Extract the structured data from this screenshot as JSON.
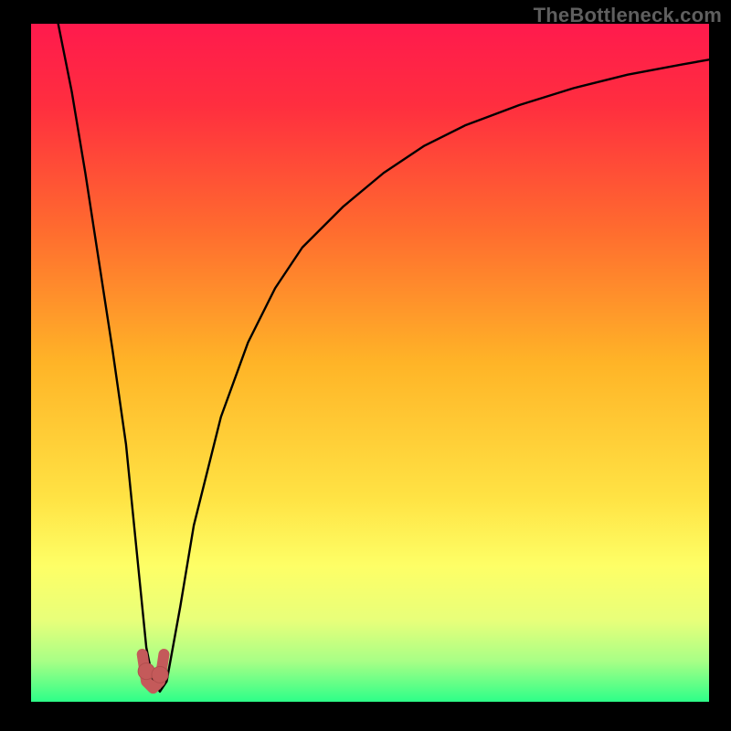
{
  "watermark": {
    "text": "TheBottleneck.com"
  },
  "colors": {
    "frame": "#000000",
    "gradient_stops": [
      {
        "offset": 0.0,
        "color": "#ff1a4d"
      },
      {
        "offset": 0.12,
        "color": "#ff2e3f"
      },
      {
        "offset": 0.3,
        "color": "#ff6a2f"
      },
      {
        "offset": 0.5,
        "color": "#ffb427"
      },
      {
        "offset": 0.7,
        "color": "#ffe344"
      },
      {
        "offset": 0.8,
        "color": "#feff66"
      },
      {
        "offset": 0.88,
        "color": "#e8ff7a"
      },
      {
        "offset": 0.94,
        "color": "#a8ff86"
      },
      {
        "offset": 1.0,
        "color": "#2dff88"
      }
    ],
    "curve_stroke": "#000000",
    "marker_fill": "#c45a5a",
    "marker_stroke": "#b14e4e"
  },
  "chart_data": {
    "type": "line",
    "title": "",
    "xlabel": "",
    "ylabel": "",
    "xlim": [
      0,
      100
    ],
    "ylim": [
      0,
      100
    ],
    "series": [
      {
        "name": "bottleneck-curve",
        "x": [
          4,
          6,
          8,
          10,
          12,
          14,
          15,
          16,
          17,
          18,
          19,
          20,
          22,
          24,
          28,
          32,
          36,
          40,
          46,
          52,
          58,
          64,
          72,
          80,
          88,
          96,
          100
        ],
        "y": [
          100,
          90,
          78,
          65,
          52,
          38,
          28,
          18,
          8,
          3,
          1.5,
          3,
          14,
          26,
          42,
          53,
          61,
          67,
          73,
          78,
          82,
          85,
          88,
          90.5,
          92.5,
          94,
          94.7
        ]
      }
    ],
    "markers": {
      "name": "optimum-band-marker",
      "points": [
        {
          "x": 17.0,
          "y": 4.5
        },
        {
          "x": 19.0,
          "y": 4.0
        }
      ],
      "u_path": [
        {
          "x": 16.4,
          "y": 7.0
        },
        {
          "x": 17.0,
          "y": 3.0
        },
        {
          "x": 18.0,
          "y": 2.0
        },
        {
          "x": 19.0,
          "y": 3.0
        },
        {
          "x": 19.6,
          "y": 7.0
        }
      ]
    }
  }
}
